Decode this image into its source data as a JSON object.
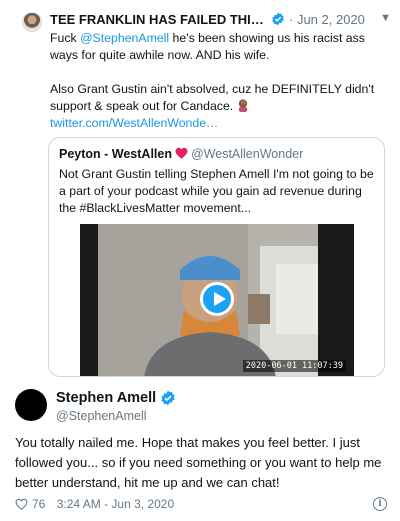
{
  "tweet1": {
    "author_name": "TEE FRANKLIN HAS FAILED THIS CO...",
    "date": "· Jun 2, 2020",
    "line1_prefix": "Fuck ",
    "mention": "@StephenAmell",
    "line1_suffix": " he's been showing us his racist ass ways for quite awhile now. AND his wife.",
    "paragraph2": "Also Grant Gustin ain't absolved, cuz he DEFINITELY didn't support & speak out for Candace.",
    "link": "twitter.com/WestAllenWonde…"
  },
  "quote": {
    "author_name": "Peyton - WestAllen",
    "handle": "@WestAllenWonder",
    "text": "Not Grant Gustin telling Stephen Amell I'm not going to be a part of your podcast while you gain ad revenue during the #BlackLivesMatter movement...",
    "video_timestamp": "2020-06-01 11:07:39"
  },
  "tweet2": {
    "author_name": "Stephen Amell",
    "handle": "@StephenAmell",
    "text": "You totally nailed me. Hope that makes you feel better. I just followed you... so if you need something or you want to help me better understand, hit me up and we can chat!",
    "likes": "76",
    "timestamp": "3:24 AM - Jun 3, 2020"
  },
  "icons": {
    "verified": "verified-badge-icon",
    "heart": "heart-icon",
    "play": "play-icon",
    "info": "info-icon",
    "caret": "chevron-down-icon"
  },
  "colors": {
    "link": "#1b95e0",
    "verified": "#1da1f2",
    "heart_red": "#e0245e",
    "muted": "#657786"
  }
}
